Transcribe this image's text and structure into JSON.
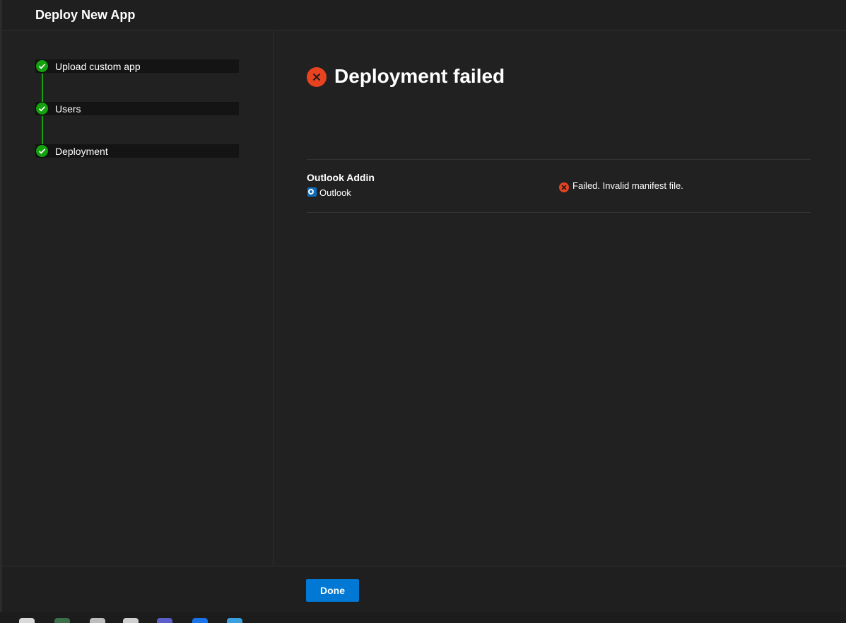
{
  "dialog": {
    "title": "Deploy New App"
  },
  "steps": [
    {
      "label": "Upload custom app",
      "status": "completed"
    },
    {
      "label": "Users",
      "status": "completed"
    },
    {
      "label": "Deployment",
      "status": "completed"
    }
  ],
  "result": {
    "title": "Deployment failed",
    "status_icon": "error-circle-icon"
  },
  "apps": [
    {
      "name": "Outlook Addin",
      "host": "Outlook",
      "host_icon": "outlook-icon",
      "status_icon": "error-circle-icon",
      "status": "Failed. Invalid manifest file."
    }
  ],
  "footer": {
    "done_label": "Done"
  },
  "colors": {
    "success": "#13a10e",
    "error": "#e74320",
    "accent": "#0078d4",
    "background": "#212121"
  },
  "taskbar": {
    "icons": [
      "notepad-icon",
      "chrome-icon",
      "file-explorer-icon",
      "editor-icon",
      "teams-icon",
      "edge-icon",
      "store-icon"
    ]
  }
}
